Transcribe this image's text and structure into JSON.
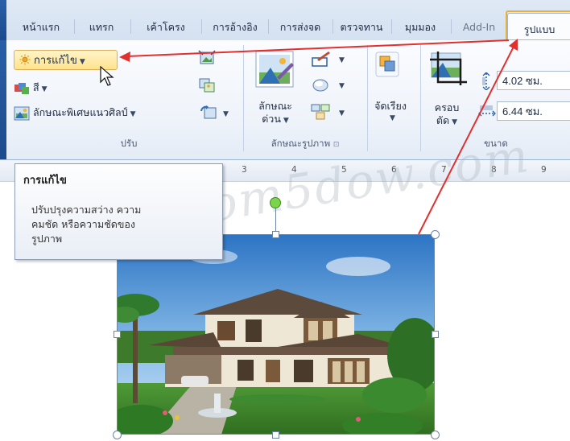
{
  "tabs": [
    {
      "label": "หน้าแรก"
    },
    {
      "label": "แทรก"
    },
    {
      "label": "เค้าโครง"
    },
    {
      "label": "การอ้างอิง"
    },
    {
      "label": "การส่งจด"
    },
    {
      "label": "ตรวจทาน"
    },
    {
      "label": "มุมมอง"
    },
    {
      "label": "Add-In"
    },
    {
      "label": "รูปแบบ"
    }
  ],
  "ribbon": {
    "adjust": {
      "corrections": "การแก้ไข",
      "color": "สี",
      "artistic": "ลักษณะพิเศษแนวศิลป์",
      "group_label": "ปรับ"
    },
    "styles": {
      "quick_styles": [
        "ลักษณะ",
        "ด่วน"
      ],
      "group_label": "ลักษณะรูปภาพ"
    },
    "arrange": {
      "label": "จัดเรียง"
    },
    "size": {
      "crop": [
        "ครอบ",
        "ตัด"
      ],
      "height": "4.02 ซม.",
      "width": "6.44 ซม.",
      "group_label": "ขนาด"
    }
  },
  "ruler": {
    "numbers": [
      "3",
      "4",
      "5",
      "6",
      "7",
      "8",
      "9"
    ]
  },
  "tooltip": {
    "title": "การแก้ไข",
    "lines": [
      "ปรับปรุงความสว่าง ความ",
      "คมชัด หรือความชัดของ",
      "รูปภาพ"
    ]
  },
  "watermark": "www.com5dow.com",
  "colors": {
    "highlight": "#e8b23a",
    "arrow": "#e2302f",
    "accent": "#2a5fa8"
  },
  "icons": [
    "sun-icon",
    "color-icon",
    "artistic-effects-icon",
    "compress-icon",
    "change-picture-icon",
    "reset-picture-icon",
    "quick-styles-icon",
    "border-icon",
    "effects-icon",
    "layout-icon",
    "arrange-icon",
    "crop-icon",
    "height-icon",
    "width-icon",
    "cursor-icon"
  ]
}
